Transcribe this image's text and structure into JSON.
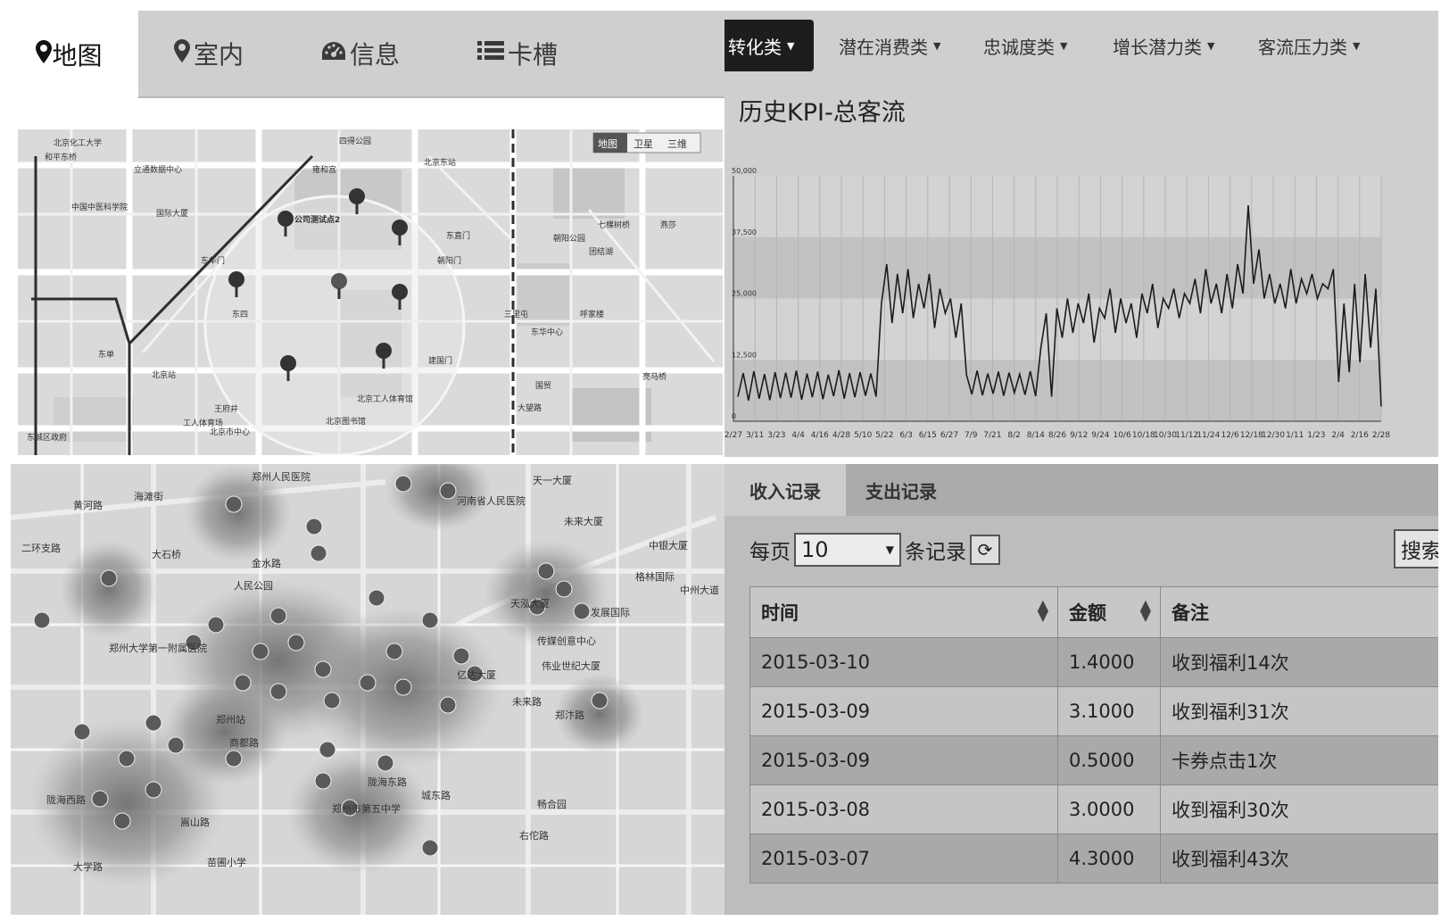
{
  "nav": {
    "active": {
      "icon": "map-marker-icon",
      "label": "地图"
    },
    "items": [
      {
        "icon": "map-marker-icon",
        "label": "室内"
      },
      {
        "icon": "dashboard-icon",
        "label": "信息"
      },
      {
        "icon": "list-icon",
        "label": "卡槽"
      }
    ]
  },
  "map1": {
    "controls": [
      "地图",
      "卫星",
      "三维"
    ],
    "labels": [
      "北京化工大学",
      "和平东桥",
      "立通数据中心",
      "中国中医科学院",
      "四得公园",
      "雍和宫",
      "北京东站",
      "国际大厦",
      "公司测试点2",
      "东华门",
      "朝阳门",
      "东四",
      "建国门",
      "北京站",
      "东单",
      "王府井",
      "工人体育场",
      "东直门",
      "团结湖",
      "朝阳公园",
      "三里屯",
      "呼家楼",
      "国贸",
      "大望路",
      "北京市中心",
      "东城区政府",
      "北京图书馆",
      "东华中心",
      "七棵树桥",
      "亮马桥",
      "燕莎",
      "北京工人体育馆"
    ]
  },
  "map2": {
    "labels": [
      "郑州人民医院",
      "天一大厦",
      "河南省人民医院",
      "未来大厦",
      "中银大厦",
      "黄河路",
      "海滩街",
      "二环支路",
      "大石桥",
      "金水路",
      "人民公园",
      "格林国际",
      "发展国际",
      "天泓大厦",
      "传媒创意中心",
      "亿达大厦",
      "伟业世纪大厦",
      "郑州大学第一附属医院",
      "中州大道",
      "郑州站",
      "陇海东路",
      "郑州市第五中学",
      "畅合园",
      "右佗路",
      "城东路",
      "郑汴路",
      "未来路",
      "大学路",
      "苗圃小学",
      "商都路",
      "陇海西路",
      "嵩山路"
    ]
  },
  "kpi": {
    "tabs": [
      {
        "label": "转化类",
        "active": true
      },
      {
        "label": "潜在消费类",
        "active": false
      },
      {
        "label": "忠诚度类",
        "active": false
      },
      {
        "label": "增长潜力类",
        "active": false
      },
      {
        "label": "客流压力类",
        "active": false
      }
    ],
    "title": "历史KPI-总客流"
  },
  "chart_data": {
    "type": "line",
    "title": "历史KPI-总客流",
    "xlabel": "",
    "ylabel": "",
    "ylim": [
      0,
      50000
    ],
    "yticks": [
      "0",
      "12,500",
      "25,000",
      "37,500",
      "50,000"
    ],
    "xticks": [
      "2/27",
      "3/11",
      "3/23",
      "4/4",
      "4/16",
      "4/28",
      "5/10",
      "5/22",
      "6/3",
      "6/15",
      "6/27",
      "7/9",
      "7/21",
      "8/2",
      "8/14",
      "8/26",
      "9/12",
      "9/24",
      "10/6",
      "10/18",
      "10/30",
      "11/12",
      "11/24",
      "12/6",
      "12/18",
      "12/30",
      "1/11",
      "1/23",
      "2/4",
      "2/16",
      "2/28"
    ],
    "grid": true,
    "series": [
      {
        "values": [
          5000,
          9800,
          4200,
          10200,
          4600,
          9600,
          4300,
          10000,
          4700,
          9900,
          4800,
          10300,
          4400,
          9700,
          4900,
          10100,
          4500,
          9500,
          5100,
          10400,
          4600,
          9800,
          4900,
          10000,
          5200,
          9700,
          5000,
          24000,
          32000,
          20000,
          30000,
          22000,
          31000,
          21000,
          28000,
          23000,
          30000,
          19000,
          27000,
          22000,
          25000,
          17000,
          24000,
          9500,
          5500,
          10300,
          5300,
          9700,
          5600,
          10100,
          5200,
          9900,
          5800,
          9600,
          5400,
          10200,
          5100,
          15000,
          22000,
          5000,
          23000,
          17000,
          25000,
          18000,
          24000,
          20000,
          26000,
          16000,
          23000,
          21000,
          27000,
          18000,
          25000,
          20000,
          24000,
          17000,
          26000,
          22000,
          28000,
          19000,
          25000,
          23000,
          27000,
          21000,
          26000,
          24000,
          29000,
          22000,
          31000,
          24000,
          28000,
          22000,
          30000,
          23000,
          32000,
          26000,
          44000,
          28000,
          35000,
          25000,
          30000,
          24000,
          28000,
          23000,
          31000,
          24000,
          29000,
          26000,
          30000,
          25000,
          28000,
          27000,
          31000,
          8000,
          24000,
          10000,
          28000,
          12000,
          30000,
          15000,
          27000,
          3000
        ]
      }
    ]
  },
  "records": {
    "tabs": [
      {
        "label": "收入记录",
        "active": true
      },
      {
        "label": "支出记录",
        "active": false
      }
    ],
    "per_page_prefix": "每页",
    "per_page_value": "10",
    "per_page_suffix": "条记录",
    "search_label": "搜索",
    "columns": [
      "时间",
      "金额",
      "备注"
    ],
    "rows": [
      {
        "time": "2015-03-10",
        "amount": "1.4000",
        "note": "收到福利14次"
      },
      {
        "time": "2015-03-09",
        "amount": "3.1000",
        "note": "收到福利31次"
      },
      {
        "time": "2015-03-09",
        "amount": "0.5000",
        "note": "卡券点击1次"
      },
      {
        "time": "2015-03-08",
        "amount": "3.0000",
        "note": "收到福利30次"
      },
      {
        "time": "2015-03-07",
        "amount": "4.3000",
        "note": "收到福利43次"
      }
    ]
  }
}
